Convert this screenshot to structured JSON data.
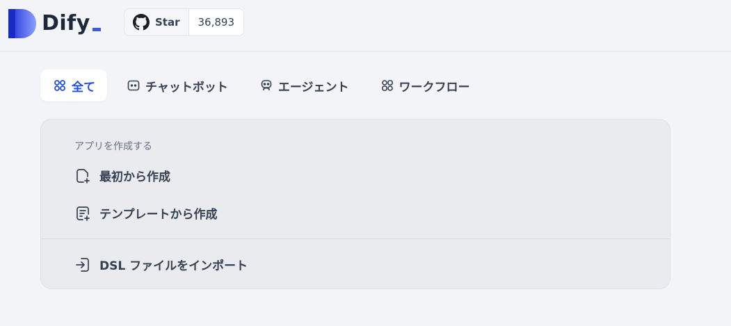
{
  "header": {
    "app_name": "Dify",
    "github": {
      "star_label": "Star",
      "star_count": "36,893"
    }
  },
  "tabs": [
    {
      "label": "全て",
      "active": true
    },
    {
      "label": "チャットボット",
      "active": false
    },
    {
      "label": "エージェント",
      "active": false
    },
    {
      "label": "ワークフロー",
      "active": false
    }
  ],
  "create_menu": {
    "section_label": "アプリを作成する",
    "items": [
      {
        "label": "最初から作成",
        "icon": "file-plus-icon"
      },
      {
        "label": "テンプレートから作成",
        "icon": "file-template-icon"
      },
      {
        "label": "DSL ファイルをインポート",
        "icon": "import-icon"
      }
    ]
  },
  "colors": {
    "accent": "#1f4fd8",
    "background": "#f2f4f7",
    "card": "#eaebef",
    "text": "#354052"
  }
}
